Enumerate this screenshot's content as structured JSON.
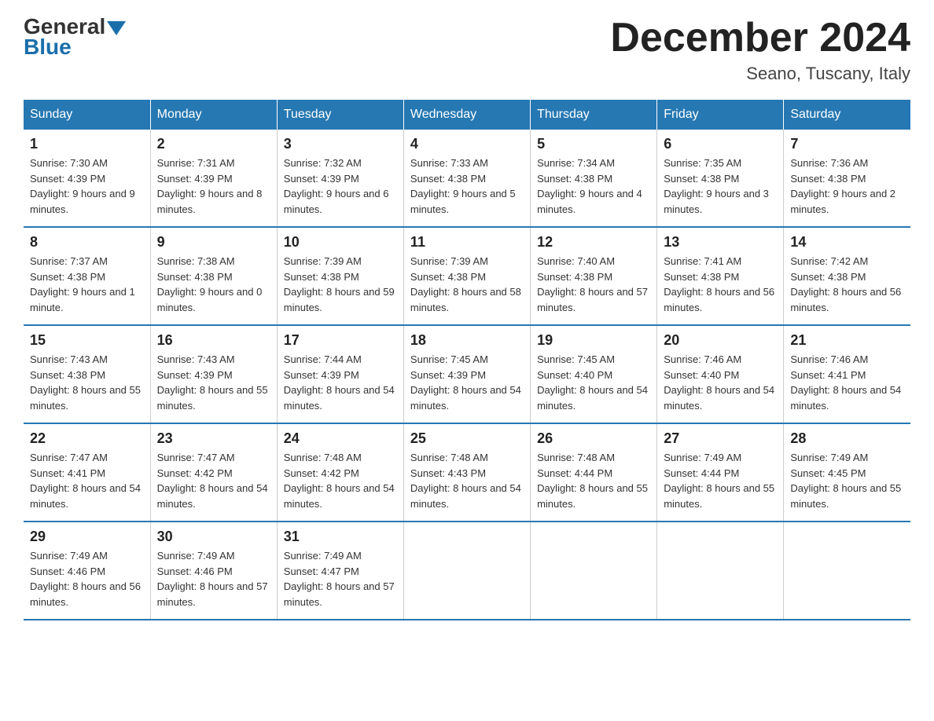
{
  "header": {
    "logo_general": "General",
    "logo_blue": "Blue",
    "month_title": "December 2024",
    "location": "Seano, Tuscany, Italy"
  },
  "days_of_week": [
    "Sunday",
    "Monday",
    "Tuesday",
    "Wednesday",
    "Thursday",
    "Friday",
    "Saturday"
  ],
  "weeks": [
    [
      {
        "day": "1",
        "sunrise": "7:30 AM",
        "sunset": "4:39 PM",
        "daylight": "9 hours and 9 minutes."
      },
      {
        "day": "2",
        "sunrise": "7:31 AM",
        "sunset": "4:39 PM",
        "daylight": "9 hours and 8 minutes."
      },
      {
        "day": "3",
        "sunrise": "7:32 AM",
        "sunset": "4:39 PM",
        "daylight": "9 hours and 6 minutes."
      },
      {
        "day": "4",
        "sunrise": "7:33 AM",
        "sunset": "4:38 PM",
        "daylight": "9 hours and 5 minutes."
      },
      {
        "day": "5",
        "sunrise": "7:34 AM",
        "sunset": "4:38 PM",
        "daylight": "9 hours and 4 minutes."
      },
      {
        "day": "6",
        "sunrise": "7:35 AM",
        "sunset": "4:38 PM",
        "daylight": "9 hours and 3 minutes."
      },
      {
        "day": "7",
        "sunrise": "7:36 AM",
        "sunset": "4:38 PM",
        "daylight": "9 hours and 2 minutes."
      }
    ],
    [
      {
        "day": "8",
        "sunrise": "7:37 AM",
        "sunset": "4:38 PM",
        "daylight": "9 hours and 1 minute."
      },
      {
        "day": "9",
        "sunrise": "7:38 AM",
        "sunset": "4:38 PM",
        "daylight": "9 hours and 0 minutes."
      },
      {
        "day": "10",
        "sunrise": "7:39 AM",
        "sunset": "4:38 PM",
        "daylight": "8 hours and 59 minutes."
      },
      {
        "day": "11",
        "sunrise": "7:39 AM",
        "sunset": "4:38 PM",
        "daylight": "8 hours and 58 minutes."
      },
      {
        "day": "12",
        "sunrise": "7:40 AM",
        "sunset": "4:38 PM",
        "daylight": "8 hours and 57 minutes."
      },
      {
        "day": "13",
        "sunrise": "7:41 AM",
        "sunset": "4:38 PM",
        "daylight": "8 hours and 56 minutes."
      },
      {
        "day": "14",
        "sunrise": "7:42 AM",
        "sunset": "4:38 PM",
        "daylight": "8 hours and 56 minutes."
      }
    ],
    [
      {
        "day": "15",
        "sunrise": "7:43 AM",
        "sunset": "4:38 PM",
        "daylight": "8 hours and 55 minutes."
      },
      {
        "day": "16",
        "sunrise": "7:43 AM",
        "sunset": "4:39 PM",
        "daylight": "8 hours and 55 minutes."
      },
      {
        "day": "17",
        "sunrise": "7:44 AM",
        "sunset": "4:39 PM",
        "daylight": "8 hours and 54 minutes."
      },
      {
        "day": "18",
        "sunrise": "7:45 AM",
        "sunset": "4:39 PM",
        "daylight": "8 hours and 54 minutes."
      },
      {
        "day": "19",
        "sunrise": "7:45 AM",
        "sunset": "4:40 PM",
        "daylight": "8 hours and 54 minutes."
      },
      {
        "day": "20",
        "sunrise": "7:46 AM",
        "sunset": "4:40 PM",
        "daylight": "8 hours and 54 minutes."
      },
      {
        "day": "21",
        "sunrise": "7:46 AM",
        "sunset": "4:41 PM",
        "daylight": "8 hours and 54 minutes."
      }
    ],
    [
      {
        "day": "22",
        "sunrise": "7:47 AM",
        "sunset": "4:41 PM",
        "daylight": "8 hours and 54 minutes."
      },
      {
        "day": "23",
        "sunrise": "7:47 AM",
        "sunset": "4:42 PM",
        "daylight": "8 hours and 54 minutes."
      },
      {
        "day": "24",
        "sunrise": "7:48 AM",
        "sunset": "4:42 PM",
        "daylight": "8 hours and 54 minutes."
      },
      {
        "day": "25",
        "sunrise": "7:48 AM",
        "sunset": "4:43 PM",
        "daylight": "8 hours and 54 minutes."
      },
      {
        "day": "26",
        "sunrise": "7:48 AM",
        "sunset": "4:44 PM",
        "daylight": "8 hours and 55 minutes."
      },
      {
        "day": "27",
        "sunrise": "7:49 AM",
        "sunset": "4:44 PM",
        "daylight": "8 hours and 55 minutes."
      },
      {
        "day": "28",
        "sunrise": "7:49 AM",
        "sunset": "4:45 PM",
        "daylight": "8 hours and 55 minutes."
      }
    ],
    [
      {
        "day": "29",
        "sunrise": "7:49 AM",
        "sunset": "4:46 PM",
        "daylight": "8 hours and 56 minutes."
      },
      {
        "day": "30",
        "sunrise": "7:49 AM",
        "sunset": "4:46 PM",
        "daylight": "8 hours and 57 minutes."
      },
      {
        "day": "31",
        "sunrise": "7:49 AM",
        "sunset": "4:47 PM",
        "daylight": "8 hours and 57 minutes."
      },
      null,
      null,
      null,
      null
    ]
  ]
}
